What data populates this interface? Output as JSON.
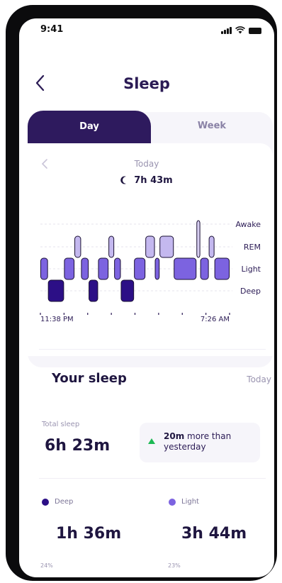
{
  "status_bar": {
    "time": "9:41"
  },
  "header": {
    "title": "Sleep"
  },
  "tabs": [
    {
      "label": "Day",
      "selected": true
    },
    {
      "label": "Week",
      "selected": false
    }
  ],
  "day_view": {
    "date": "Today",
    "total_duration": "7h 43m"
  },
  "chart_data": {
    "type": "hypnogram",
    "stages": [
      "Awake",
      "REM",
      "Light",
      "Deep"
    ],
    "start_label": "11:38 PM",
    "end_label": "7:26 AM",
    "segments": [
      {
        "stage": "Light",
        "start": 0.0,
        "end": 0.04
      },
      {
        "stage": "Deep",
        "start": 0.04,
        "end": 0.125
      },
      {
        "stage": "Light",
        "start": 0.125,
        "end": 0.18
      },
      {
        "stage": "REM",
        "start": 0.18,
        "end": 0.215
      },
      {
        "stage": "Light",
        "start": 0.215,
        "end": 0.255
      },
      {
        "stage": "Deep",
        "start": 0.255,
        "end": 0.305
      },
      {
        "stage": "Light",
        "start": 0.305,
        "end": 0.36
      },
      {
        "stage": "REM",
        "start": 0.36,
        "end": 0.39
      },
      {
        "stage": "Light",
        "start": 0.39,
        "end": 0.425
      },
      {
        "stage": "Deep",
        "start": 0.425,
        "end": 0.495
      },
      {
        "stage": "Light",
        "start": 0.495,
        "end": 0.555
      },
      {
        "stage": "REM",
        "start": 0.555,
        "end": 0.605
      },
      {
        "stage": "Light",
        "start": 0.605,
        "end": 0.63
      },
      {
        "stage": "REM",
        "start": 0.63,
        "end": 0.705
      },
      {
        "stage": "Light",
        "start": 0.705,
        "end": 0.825
      },
      {
        "stage": "Awake",
        "start": 0.825,
        "end": 0.845
      },
      {
        "stage": "Light",
        "start": 0.845,
        "end": 0.89
      },
      {
        "stage": "REM",
        "start": 0.89,
        "end": 0.92
      },
      {
        "stage": "Light",
        "start": 0.92,
        "end": 1.0
      }
    ],
    "colors": {
      "Awake": "#d8cff2",
      "REM": "#c4b8ef",
      "Light": "#7c63e0",
      "Deep": "#2c0f86"
    }
  },
  "your_sleep": {
    "title": "Your sleep",
    "date": "Today",
    "total_label": "Total sleep",
    "total_value": "6h 23m",
    "compare_bold": "20m",
    "compare_rest": " more than yesterday",
    "deep": {
      "label": "Deep",
      "value": "1h 36m",
      "percent": "24%",
      "color": "#2c0f86"
    },
    "light": {
      "label": "Light",
      "value": "3h 44m",
      "percent": "23%",
      "color": "#7c63e0"
    }
  },
  "colors": {
    "accent_dark": "#2e1a5e",
    "increase": "#1db954"
  }
}
